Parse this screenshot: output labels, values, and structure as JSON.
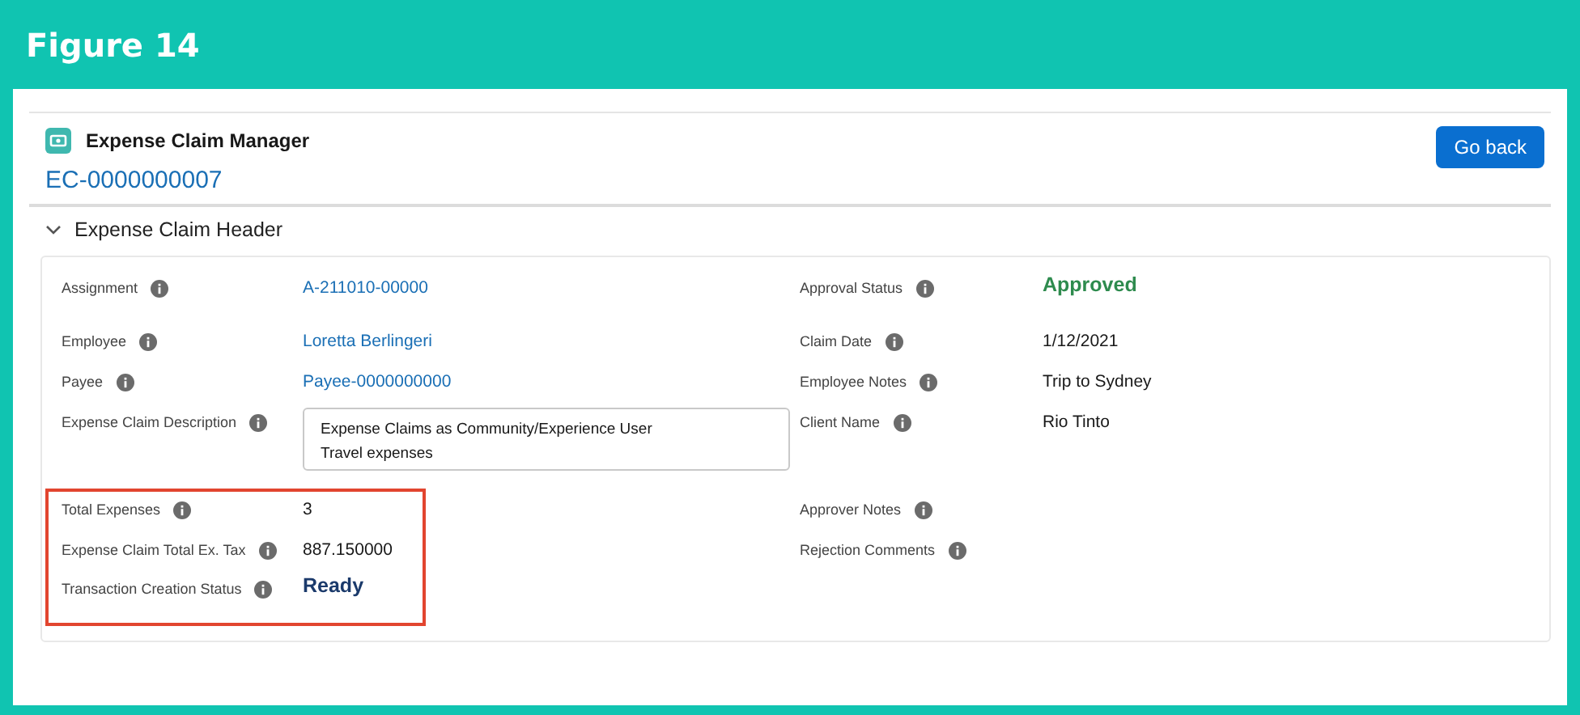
{
  "figure_title": "Figure 14",
  "app": {
    "title": "Expense Claim Manager",
    "record_name": "EC-0000000007",
    "back_button": "Go back"
  },
  "section": {
    "title": "Expense Claim Header",
    "expanded": true
  },
  "left_fields": [
    {
      "label": "Assignment",
      "kind": "link",
      "value": "A-211010-00000",
      "highlighted": false
    },
    {
      "label": "Employee",
      "kind": "link",
      "value": "Loretta Berlingeri",
      "highlighted": false
    },
    {
      "label": "Payee",
      "kind": "link",
      "value": "Payee-0000000000",
      "highlighted": false
    },
    {
      "label": "Expense Claim Description",
      "kind": "textarea",
      "value": "Expense Claims as Community/Experience User\nTravel expenses",
      "highlighted": false
    },
    {
      "label": "Total Expenses",
      "kind": "text",
      "value": "3",
      "highlighted": true
    },
    {
      "label": "Expense Claim Total Ex. Tax",
      "kind": "text",
      "value": "887.150000",
      "highlighted": true
    },
    {
      "label": "Transaction Creation Status",
      "kind": "status",
      "value": "Ready",
      "color": "#1b3a6b",
      "highlighted": true
    }
  ],
  "right_fields": [
    {
      "label": "Approval Status",
      "kind": "status",
      "value": "Approved",
      "color": "#2e8b4e"
    },
    {
      "label": "Claim Date",
      "kind": "text",
      "value": "1/12/2021"
    },
    {
      "label": "Employee Notes",
      "kind": "text",
      "value": "Trip to Sydney"
    },
    {
      "label": "Client Name",
      "kind": "text",
      "value": "Rio Tinto"
    },
    {
      "label": "Approver Notes",
      "kind": "empty"
    },
    {
      "label": "Rejection Comments",
      "kind": "empty"
    }
  ]
}
